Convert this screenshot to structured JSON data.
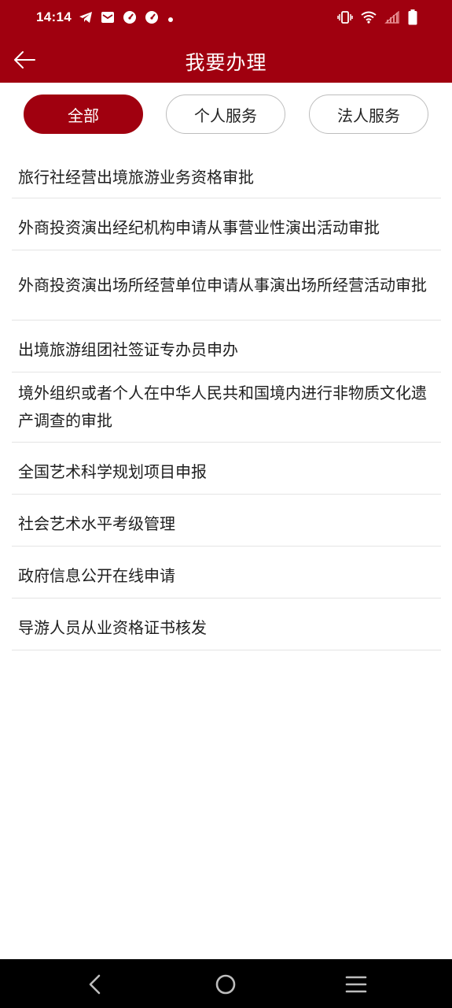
{
  "status_bar": {
    "time": "14:14",
    "left_icons": [
      "telegram-icon",
      "mail-icon",
      "gauge-icon",
      "gauge-icon",
      "dot-icon"
    ],
    "right_icons": [
      "vibrate-icon",
      "wifi-icon",
      "signal-icon",
      "battery-icon"
    ]
  },
  "header": {
    "title": "我要办理",
    "back_icon": "arrow-left-icon"
  },
  "tabs": [
    {
      "label": "全部",
      "active": true
    },
    {
      "label": "个人服务",
      "active": false
    },
    {
      "label": "法人服务",
      "active": false
    }
  ],
  "items": [
    "旅行社经营出境旅游业务资格审批",
    "外商投资演出经纪机构申请从事营业性演出活动审批",
    "外商投资演出场所经营单位申请从事演出场所经营活动审批",
    "出境旅游组团社签证专办员申办",
    "境外组织或者个人在中华人民共和国境内进行非物质文化遗产调查的审批",
    "全国艺术科学规划项目申报",
    "社会艺术水平考级管理",
    "政府信息公开在线申请",
    "导游人员从业资格证书核发"
  ],
  "nav": [
    "back-icon",
    "home-icon",
    "menu-icon"
  ],
  "colors": {
    "brand": "#a0000f",
    "text": "#1e1e1e",
    "divider": "#e4e4e4"
  }
}
